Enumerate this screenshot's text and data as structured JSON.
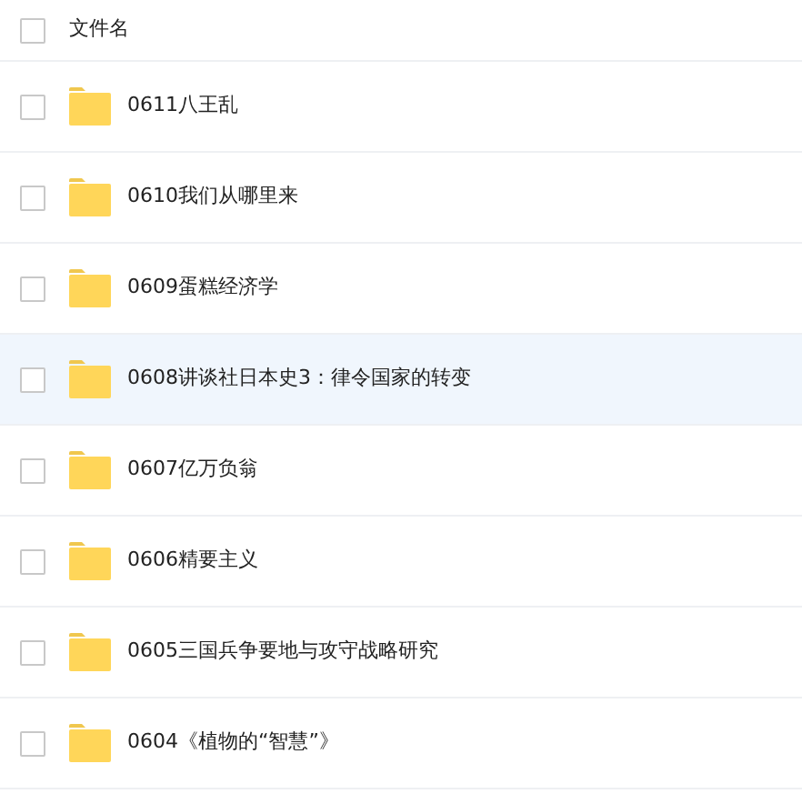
{
  "header": {
    "label": "文件名",
    "checked": false
  },
  "files": [
    {
      "name": "0611八王乱",
      "checked": false,
      "hovered": false
    },
    {
      "name": "0610我们从哪里来",
      "checked": false,
      "hovered": false
    },
    {
      "name": "0609蛋糕经济学",
      "checked": false,
      "hovered": false
    },
    {
      "name": "0608讲谈社日本史3：律令国家的转变",
      "checked": false,
      "hovered": true
    },
    {
      "name": "0607亿万负翁",
      "checked": false,
      "hovered": false
    },
    {
      "name": "0606精要主义",
      "checked": false,
      "hovered": false
    },
    {
      "name": "0605三国兵争要地与攻守战略研究",
      "checked": false,
      "hovered": false
    },
    {
      "name": "0604《植物的“智慧”》",
      "checked": false,
      "hovered": false
    }
  ]
}
